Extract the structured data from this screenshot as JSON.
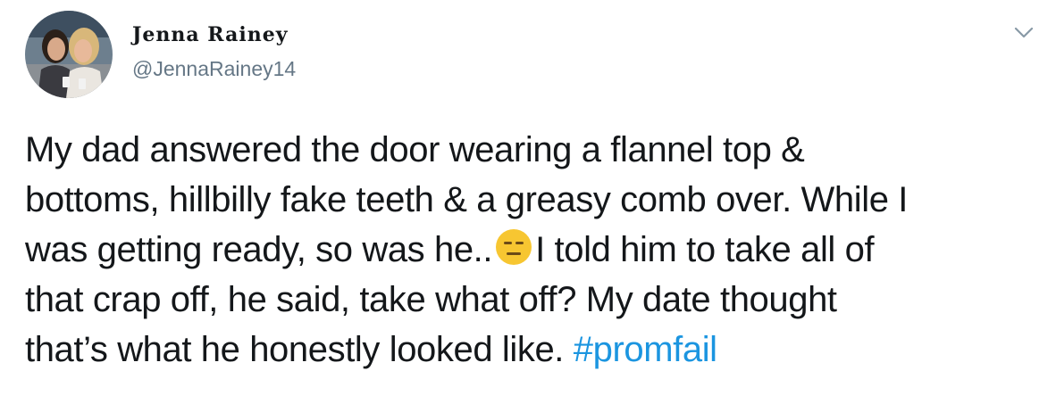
{
  "author": {
    "display_name": "Jenna Rainey",
    "handle": "@JennaRainey14"
  },
  "menu": {
    "icon": "chevron-down-icon"
  },
  "tweet": {
    "line1": "My dad answered the door wearing a flannel top &",
    "line2": "bottoms, hillbilly fake teeth & a greasy comb over. While I",
    "line3a": "was getting ready, so was he..",
    "emoji": "expressionless-face-emoji",
    "line3b": "I told him to take all of",
    "line4": "that crap off, he said, take what off? My date thought",
    "line5": "that’s what he honestly looked like. ",
    "hashtag": "#promfail"
  },
  "colors": {
    "text": "#14171a",
    "secondary": "#657786",
    "link": "#1b95e0",
    "emoji": "#f7c631"
  }
}
